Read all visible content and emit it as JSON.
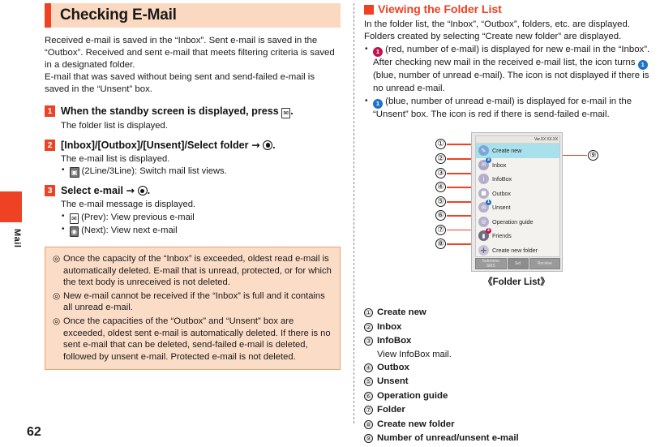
{
  "sidebar": {
    "tab_label": "Mail",
    "page_number": "62"
  },
  "left_column": {
    "title": "Checking E-Mail",
    "intro_paragraphs": [
      "Received e-mail is saved in the “Inbox”. Sent e-mail is saved in the “Outbox”. Received and sent e-mail that meets filtering criteria is saved in a designated folder.",
      "E-mail that was saved without being sent and send-failed e-mail is saved in the “Unsent” box."
    ],
    "steps": [
      {
        "number": "1",
        "title_pre": "When the standby screen is displayed, press ",
        "title_key": "✉",
        "title_post": ".",
        "desc": "The folder list is displayed.",
        "bullets": []
      },
      {
        "number": "2",
        "title_pre": "[Inbox]/[Outbox]/[Unsent]/Select folder ",
        "title_key": "",
        "title_post": ".",
        "desc": "The e-mail list is displayed.",
        "bullets": [
          {
            "key": "▣",
            "text": "(2Line/3Line): Switch mail list views."
          }
        ]
      },
      {
        "number": "3",
        "title_pre": "Select e-mail ",
        "title_key": "",
        "title_post": ".",
        "desc": "The e-mail message is displayed.",
        "bullets": [
          {
            "key": "✉",
            "text": "(Prev): View previous e-mail"
          },
          {
            "key": "◉",
            "text": "(Next): View next e-mail"
          }
        ]
      }
    ],
    "notes": [
      "Once the capacity of the “Inbox” is exceeded, oldest read e-mail is automatically deleted. E-mail that is unread, protected, or for which the text body is unreceived is not deleted.",
      "New e-mail cannot be received if the “Inbox” is full and it contains all unread e-mail.",
      "Once the capacities of the “Outbox” and “Unsent” box are exceeded, oldest sent e-mail is automatically deleted. If there is no sent e-mail that can be deleted, send-failed e-mail is deleted, followed by unsent e-mail. Protected e-mail is not deleted."
    ]
  },
  "right_column": {
    "heading": "Viewing the Folder List",
    "paragraphs": [
      "In the folder list, the “Inbox”, “Outbox”, folders, etc. are displayed. Folders created by selecting “Create new folder” are displayed."
    ],
    "bullets": [
      {
        "seg1_badge": "1",
        "seg1_badge_color": "red",
        "seg1": " (red, number of e-mail) is displayed for new e-mail in the “Inbox”. After checking new mail in the received e-mail list, the icon turns ",
        "seg2_badge": "1",
        "seg2_badge_color": "blue",
        "seg2": " (blue, number of unread e-mail). The icon is not displayed if there is no unread e-mail."
      },
      {
        "seg1_badge": "1",
        "seg1_badge_color": "blue",
        "seg1": " (blue, number of unread e-mail) is displayed for e-mail in the “Unsent” box. The icon is red if there is send-failed e-mail.",
        "seg2_badge": "",
        "seg2_badge_color": "",
        "seg2": ""
      }
    ],
    "figure": {
      "caption": "《Folder List》",
      "status_version": "Ver.XX XX.XX",
      "rows": [
        {
          "label": "Create new",
          "icon_color": "#7aa7d8",
          "icon_glyph": "✎",
          "badge": "",
          "badge_color": "",
          "selected": true
        },
        {
          "label": "Inbox",
          "icon_color": "#a9a6c4",
          "icon_glyph": "✉",
          "badge": "3",
          "badge_color": "#1f72c8",
          "selected": false
        },
        {
          "label": "InfoBox",
          "icon_color": "#b3b0cb",
          "icon_glyph": "i",
          "badge": "",
          "badge_color": "",
          "selected": false
        },
        {
          "label": "Outbox",
          "icon_color": "#b3b0cb",
          "icon_glyph": "■",
          "badge": "",
          "badge_color": "",
          "selected": false
        },
        {
          "label": "Unsent",
          "icon_color": "#b3b0cb",
          "icon_glyph": "✉",
          "badge": "1",
          "badge_color": "#1f72c8",
          "selected": false
        },
        {
          "label": "Operation guide",
          "icon_color": "#b3b0cb",
          "icon_glyph": "◎",
          "badge": "",
          "badge_color": "",
          "selected": false
        },
        {
          "label": "Friends",
          "icon_color": "#6f6b80",
          "icon_glyph": "▰",
          "badge": "2",
          "badge_color": "#c0134f",
          "selected": false
        },
        {
          "label": "Create new folder",
          "icon_color": "#c9c5d4",
          "icon_glyph": "+",
          "badge": "",
          "badge_color": "",
          "selected": false
        }
      ],
      "softkeys": [
        {
          "top": "Submenu",
          "bottom": "SMS"
        },
        {
          "top": "Sel",
          "bottom": ""
        },
        {
          "top": "",
          "bottom": "Receive"
        }
      ],
      "callouts": [
        "①",
        "②",
        "③",
        "④",
        "⑤",
        "⑥",
        "⑦",
        "⑧"
      ],
      "callout_right": "⑨"
    },
    "legend": [
      {
        "num": "①",
        "label": "Create new",
        "sub": ""
      },
      {
        "num": "②",
        "label": "Inbox",
        "sub": ""
      },
      {
        "num": "③",
        "label": "InfoBox",
        "sub": "View InfoBox mail."
      },
      {
        "num": "④",
        "label": "Outbox",
        "sub": ""
      },
      {
        "num": "⑤",
        "label": "Unsent",
        "sub": ""
      },
      {
        "num": "⑥",
        "label": "Operation guide",
        "sub": ""
      },
      {
        "num": "⑦",
        "label": "Folder",
        "sub": ""
      },
      {
        "num": "⑧",
        "label": "Create new folder",
        "sub": ""
      },
      {
        "num": "⑨",
        "label": "Number of unread/unsent e-mail",
        "sub": ""
      }
    ]
  }
}
